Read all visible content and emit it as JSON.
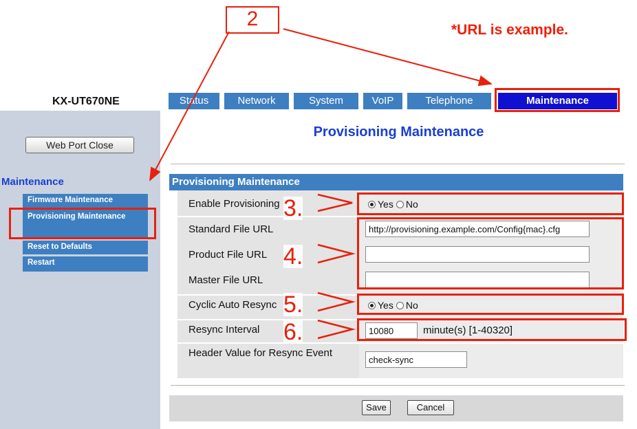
{
  "annotations": {
    "step2": "2",
    "step3": "3.",
    "step4": "4.",
    "step5": "5.",
    "step6": "6.",
    "url_note": "*URL is example.",
    "color": "#e8200c"
  },
  "header": {
    "model": "KX-UT670NE",
    "tabs": [
      {
        "label": "Status"
      },
      {
        "label": "Network"
      },
      {
        "label": "System"
      },
      {
        "label": "VoIP"
      },
      {
        "label": "Telephone"
      },
      {
        "label": "Maintenance",
        "active": true
      }
    ]
  },
  "sidebar": {
    "web_port_close": "Web Port Close",
    "section_title": "Maintenance",
    "items": [
      {
        "label": "Firmware Maintenance"
      },
      {
        "label": "Provisioning Maintenance",
        "active": true
      },
      {
        "label": "Reset to Defaults"
      },
      {
        "label": "Restart"
      }
    ]
  },
  "main": {
    "page_title": "Provisioning Maintenance",
    "section_title": "Provisioning Maintenance",
    "rows": {
      "enable_provisioning": {
        "label": "Enable Provisioning",
        "yes": "Yes",
        "no": "No",
        "selected": "Yes"
      },
      "standard_file_url": {
        "label": "Standard File URL",
        "value": "http://provisioning.example.com/Config{mac}.cfg"
      },
      "product_file_url": {
        "label": "Product File URL",
        "value": ""
      },
      "master_file_url": {
        "label": "Master File URL",
        "value": ""
      },
      "cyclic_auto_resync": {
        "label": "Cyclic Auto Resync",
        "yes": "Yes",
        "no": "No",
        "selected": "Yes"
      },
      "resync_interval": {
        "label": "Resync Interval",
        "value": "10080",
        "unit": "minute(s) [1-40320]"
      },
      "header_value": {
        "label": "Header Value for Resync Event",
        "value": "check-sync"
      }
    },
    "buttons": {
      "save": "Save",
      "cancel": "Cancel"
    }
  }
}
